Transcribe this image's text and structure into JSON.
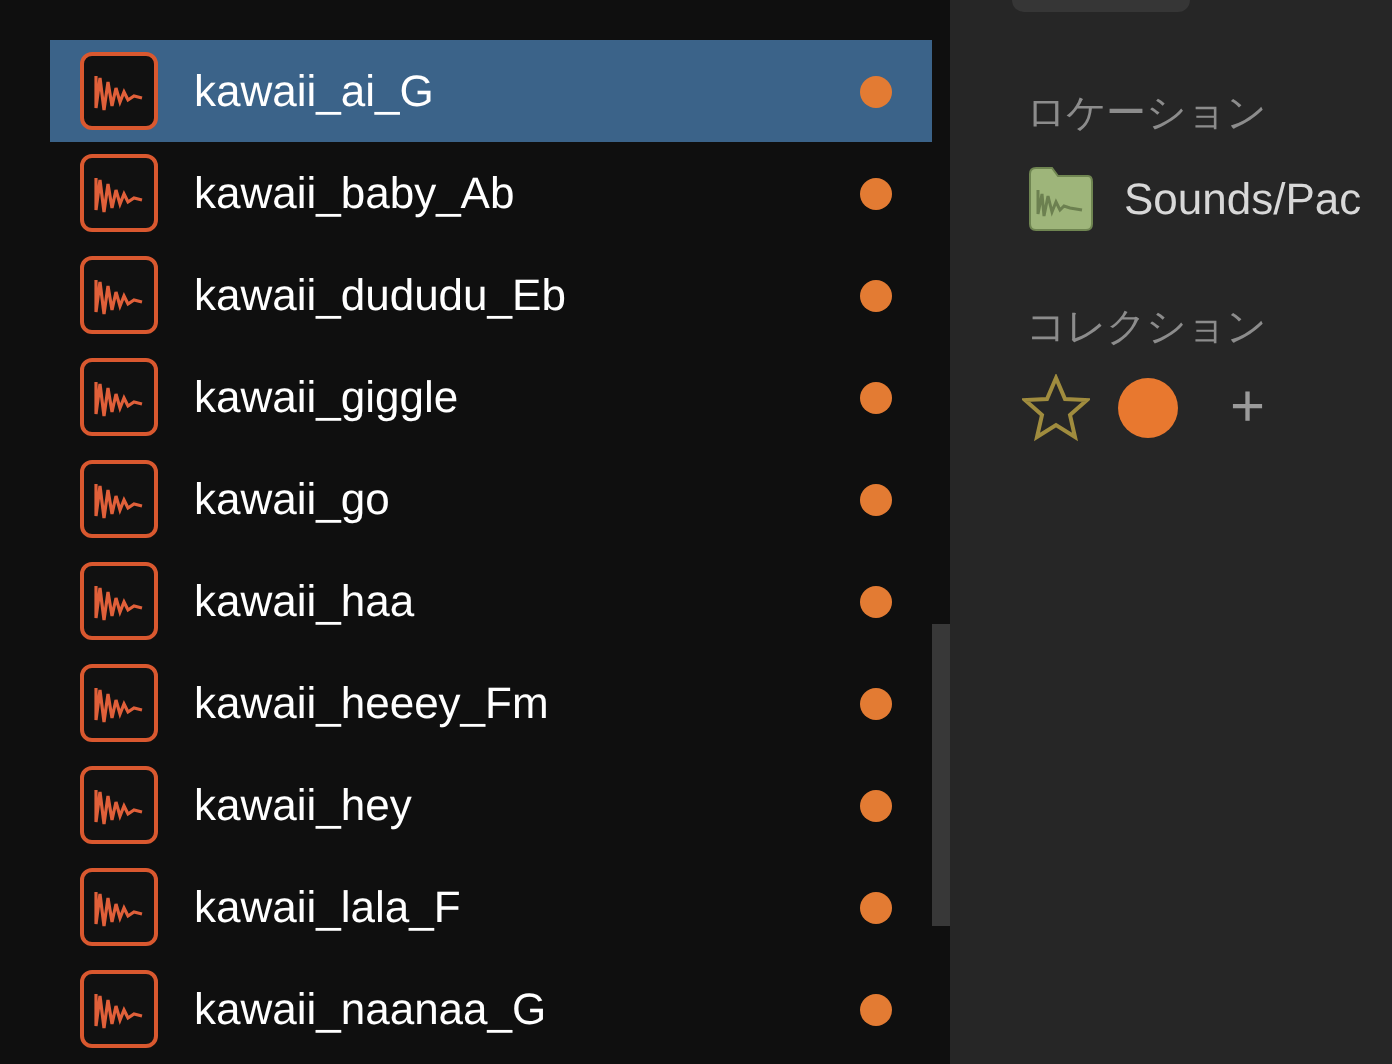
{
  "files": [
    {
      "name": "kawaii_ai_G",
      "selected": true,
      "color": "#e37b33"
    },
    {
      "name": "kawaii_baby_Ab",
      "selected": false,
      "color": "#e37b33"
    },
    {
      "name": "kawaii_dududu_Eb",
      "selected": false,
      "color": "#e37b33"
    },
    {
      "name": "kawaii_giggle",
      "selected": false,
      "color": "#e37b33"
    },
    {
      "name": "kawaii_go",
      "selected": false,
      "color": "#e37b33"
    },
    {
      "name": "kawaii_haa",
      "selected": false,
      "color": "#e37b33"
    },
    {
      "name": "kawaii_heeey_Fm",
      "selected": false,
      "color": "#e37b33"
    },
    {
      "name": "kawaii_hey",
      "selected": false,
      "color": "#e37b33"
    },
    {
      "name": "kawaii_lala_F",
      "selected": false,
      "color": "#e37b33"
    },
    {
      "name": "kawaii_naanaa_G",
      "selected": false,
      "color": "#e37b33"
    }
  ],
  "details": {
    "location_label": "ロケーション",
    "location": "Sounds/Pac",
    "collection_label": "コレクション",
    "collections": [
      {
        "kind": "star"
      },
      {
        "kind": "color",
        "color": "#e8782f"
      }
    ],
    "add": "+"
  }
}
